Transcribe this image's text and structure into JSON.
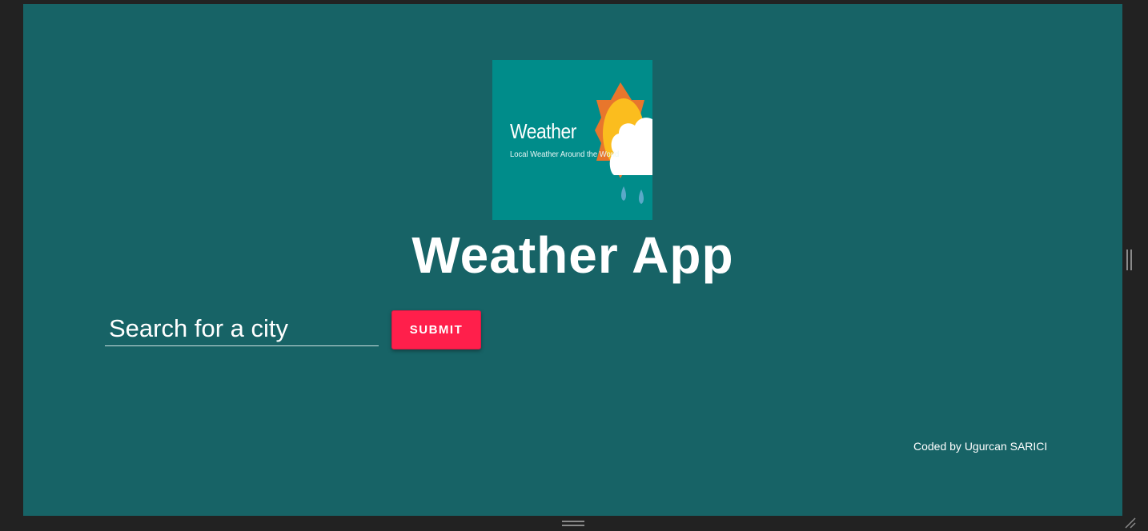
{
  "logo": {
    "title": "Weather",
    "subtitle": "Local Weather Around the World",
    "bg_color": "#008c8a",
    "sun_color": "#fbbd1e",
    "sun_ray_color": "#e8762c",
    "cloud_color": "#ffffff",
    "rain_color": "#5aa9c8"
  },
  "app": {
    "title": "Weather App",
    "bg_color": "#176366"
  },
  "search": {
    "placeholder": "Search for a city",
    "value": ""
  },
  "submit": {
    "label": "SUBMIT",
    "color": "#ff1f4b"
  },
  "footer": {
    "credit": "Coded by Ugurcan SARICI"
  },
  "icons": {
    "scroll_right": "vertical-resize-handle-icon",
    "scroll_bottom": "horizontal-resize-handle-icon",
    "resize": "corner-resize-grip-icon"
  }
}
